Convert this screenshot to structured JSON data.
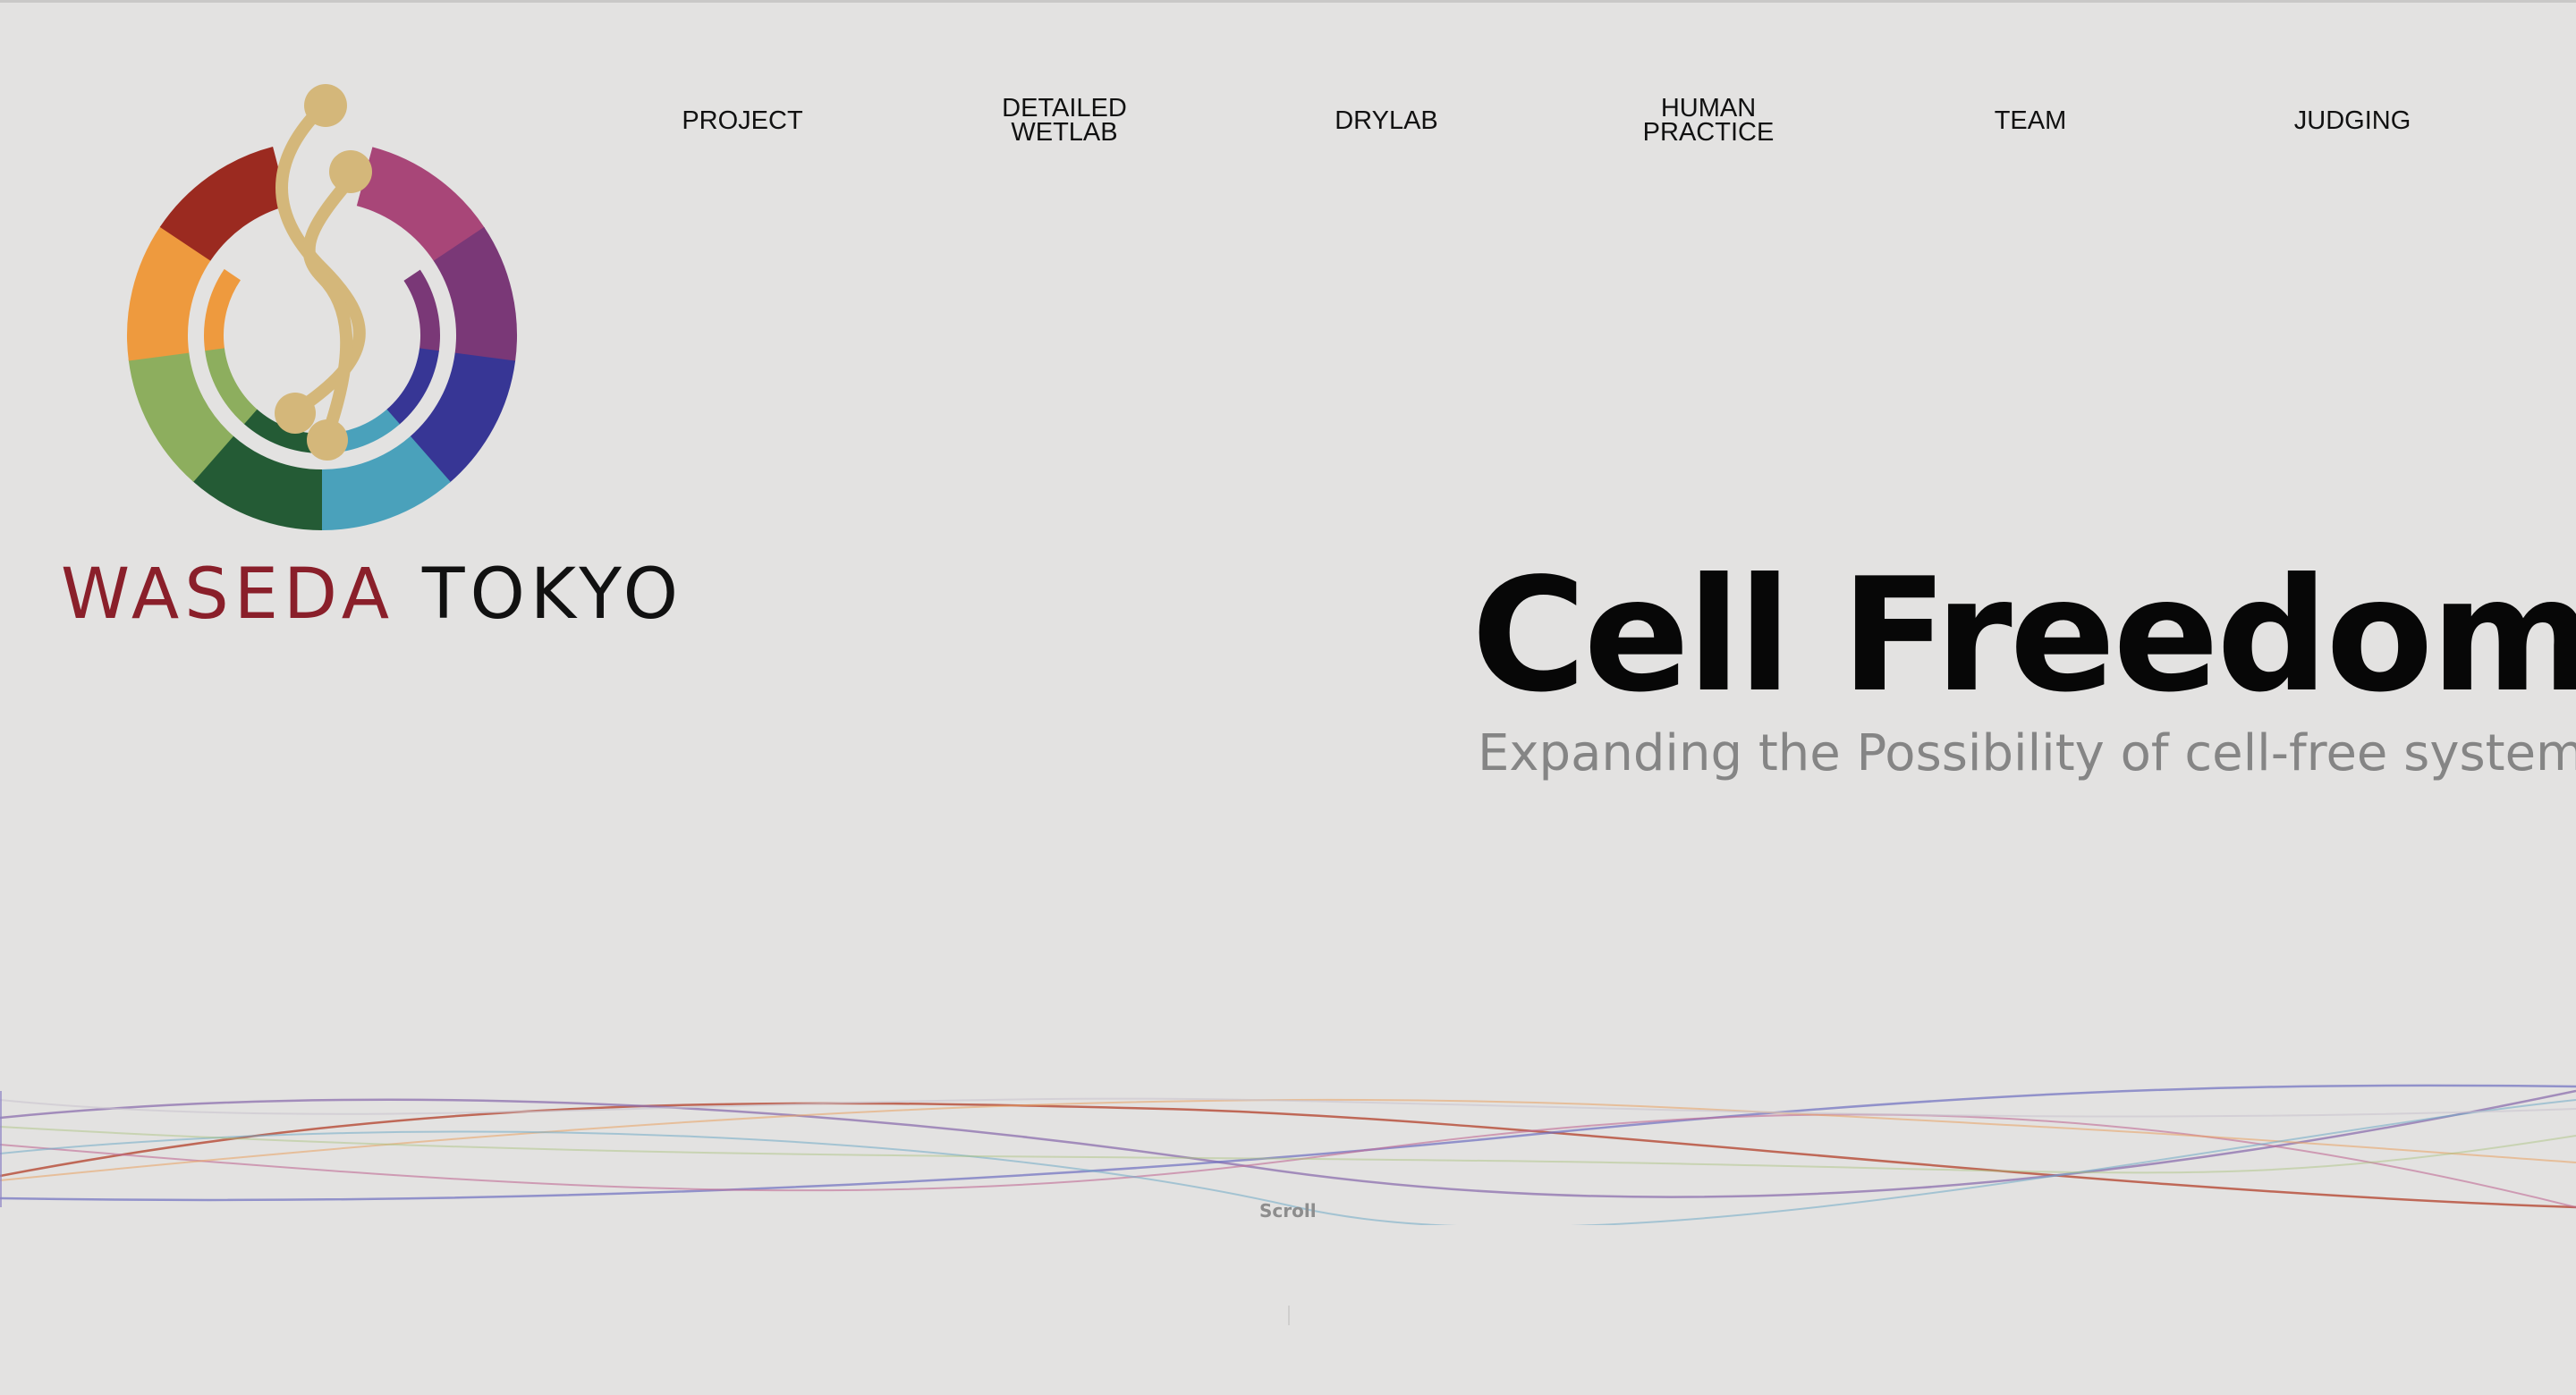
{
  "brand": {
    "name_part1": "WASEDA",
    "name_part2": "TOKYO",
    "accent_red": "#8a1f2a",
    "logo_icon": "helix-ring-logo"
  },
  "nav": {
    "items": [
      {
        "line1": "PROJECT",
        "line2": ""
      },
      {
        "line1": "DETAILED",
        "line2": "WETLAB"
      },
      {
        "line1": "DRYLAB",
        "line2": ""
      },
      {
        "line1": "HUMAN",
        "line2": "PRACTICE"
      },
      {
        "line1": "TEAM",
        "line2": ""
      },
      {
        "line1": "JUDGING",
        "line2": ""
      }
    ]
  },
  "hero": {
    "title": "Cell Freedom",
    "subtitle": "Expanding the Possibility of cell-free system"
  },
  "scroll": {
    "label": "Scroll"
  },
  "colors": {
    "background": "#e3e2e1",
    "ring": [
      "#9b2a20",
      "#a84678",
      "#7a3877",
      "#373695",
      "#4aa1bb",
      "#245b35",
      "#8dae5e",
      "#ee9a3e"
    ],
    "helix": "#d4b77a"
  }
}
